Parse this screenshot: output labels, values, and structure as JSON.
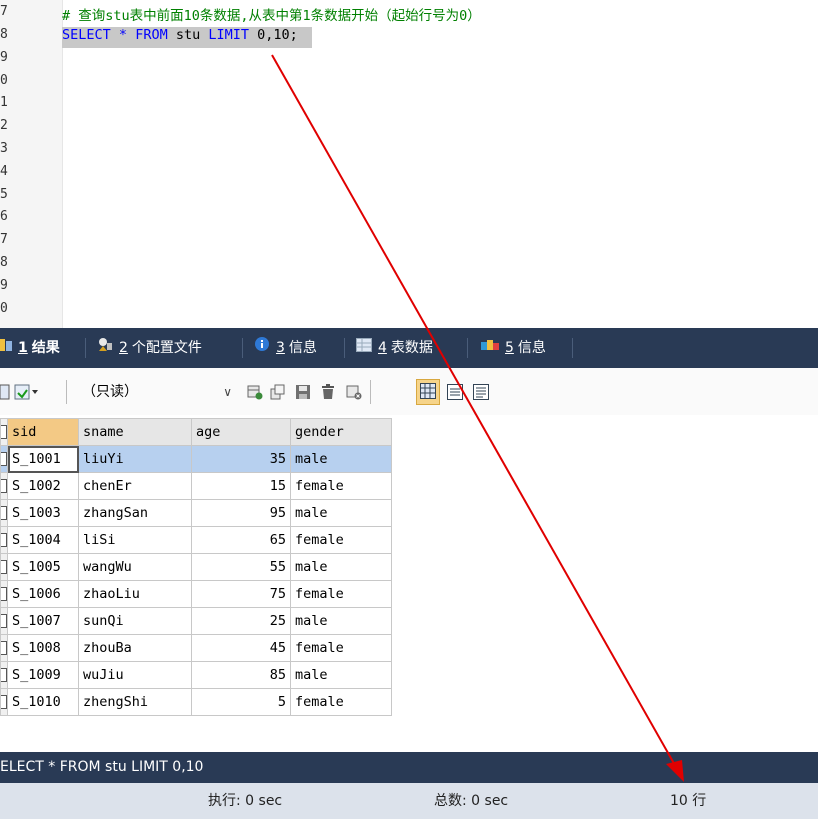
{
  "editor": {
    "line_numbers": [
      "7",
      "8",
      "9",
      "0",
      "1",
      "2",
      "3",
      "4",
      "5",
      "6",
      "7",
      "8",
      "9",
      "0"
    ],
    "comment": "# 查询stu表中前面10条数据,从表中第1条数据开始（起始行号为0）",
    "sql_tokens": {
      "select": "SELECT",
      "star": "*",
      "from": "FROM",
      "table": "stu",
      "limit": "LIMIT",
      "args": "0,10;"
    }
  },
  "tabs": [
    {
      "num": "1",
      "label": "结果"
    },
    {
      "num": "2",
      "label": "个配置文件"
    },
    {
      "num": "3",
      "label": "信息"
    },
    {
      "num": "4",
      "label": "表数据"
    },
    {
      "num": "5",
      "label": "信息"
    }
  ],
  "toolbar": {
    "mode_select": "（只读）"
  },
  "result": {
    "columns": [
      "sid",
      "sname",
      "age",
      "gender"
    ],
    "rows": [
      [
        "S_1001",
        "liuYi",
        "35",
        "male"
      ],
      [
        "S_1002",
        "chenEr",
        "15",
        "female"
      ],
      [
        "S_1003",
        "zhangSan",
        "95",
        "male"
      ],
      [
        "S_1004",
        "liSi",
        "65",
        "female"
      ],
      [
        "S_1005",
        "wangWu",
        "55",
        "male"
      ],
      [
        "S_1006",
        "zhaoLiu",
        "75",
        "female"
      ],
      [
        "S_1007",
        "sunQi",
        "25",
        "male"
      ],
      [
        "S_1008",
        "zhouBa",
        "45",
        "female"
      ],
      [
        "S_1009",
        "wuJiu",
        "85",
        "male"
      ],
      [
        "S_1010",
        "zhengShi",
        "5",
        "female"
      ]
    ]
  },
  "query_bar": {
    "text": "ELECT * FROM stu LIMIT 0,10"
  },
  "status": {
    "exec": "执行: 0 sec",
    "total": "总数: 0 sec",
    "rows": "10 行"
  },
  "colors": {
    "tab_bar": "#293a55",
    "keyword": "#0000ff",
    "comment": "#008000",
    "annotation": "#e00000"
  }
}
